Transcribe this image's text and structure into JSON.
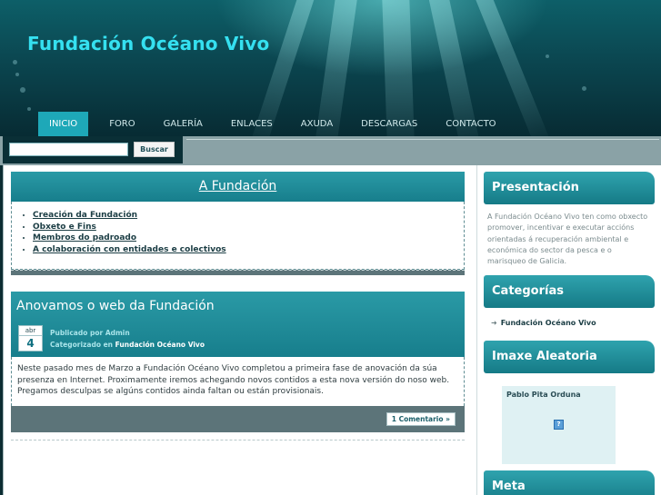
{
  "site": {
    "title": "Fundación Océano Vivo"
  },
  "nav": {
    "items": [
      {
        "label": "INICIO",
        "active": true
      },
      {
        "label": "FORO",
        "active": false
      },
      {
        "label": "GALERÍA",
        "active": false
      },
      {
        "label": "ENLACES",
        "active": false
      },
      {
        "label": "AXUDA",
        "active": false
      },
      {
        "label": "DESCARGAS",
        "active": false
      },
      {
        "label": "CONTACTO",
        "active": false
      }
    ]
  },
  "search": {
    "value": "",
    "button_label": "Buscar"
  },
  "about_box": {
    "title": "A Fundación",
    "links": [
      "Creación da Fundación",
      "Obxeto e Fins",
      "Membros do padroado",
      "A colaboración con entidades e colectivos"
    ]
  },
  "post": {
    "title": "Anovamos o web da Fundación",
    "date_month": "abr",
    "date_day": "4",
    "published_by_label": "Publicado por Admin",
    "category_label": "Categorizado en",
    "category_value": "Fundación Océano Vivo",
    "body": "Neste pasado mes de Marzo a Fundación Océano Vivo completou a primeira fase de anovación da súa presenza en Internet. Proximamente iremos achegando novos contidos a esta nova versión do noso web. Pregamos desculpas se algúns contidos ainda faltan ou están provisionais.",
    "comments_label": "1 Comentario »"
  },
  "sidebar": {
    "presentation_title": "Presentación",
    "presentation_text": "A Fundación Océano Vivo ten como obxecto promover, incentivar e executar accións orientadas á recuperación ambiental e económica do sector da pesca e o marisqueo de Galicia.",
    "categories_title": "Categorías",
    "category_item": "Fundación Océano Vivo",
    "random_image_title": "Imaxe Aleatoria",
    "random_image_caption": "Pablo Pita Orduna",
    "meta_title": "Meta"
  },
  "colors": {
    "accent": "#1ea8b8",
    "title": "#35e0f0",
    "panel": "#177e8c",
    "footer_bar": "#5c7479"
  }
}
